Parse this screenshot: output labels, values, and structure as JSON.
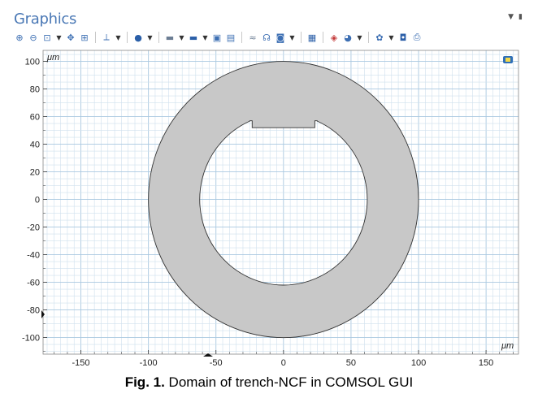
{
  "window": {
    "title": "Graphics"
  },
  "toolbar": {
    "icons": [
      "zoom-in-icon",
      "zoom-out-icon",
      "zoom-box-icon",
      "dropdown-arrow-icon",
      "move-icon",
      "zoom-extents-icon",
      "axis-orientation-icon",
      "dropdown-arrow-icon",
      "select-object-icon",
      "dropdown-arrow-icon",
      "scene-light-icon",
      "dropdown-arrow-icon",
      "camera-view-icon",
      "dropdown-arrow-icon",
      "select-box-icon",
      "deselect-box-icon",
      "hide-icon",
      "render-icon",
      "transparency-icon",
      "dropdown-arrow-icon",
      "grid-toggle-icon",
      "mesh-icon",
      "color-icon",
      "dropdown-arrow-icon",
      "settings-icon",
      "dropdown-arrow-icon",
      "snapshot-icon",
      "print-icon"
    ]
  },
  "axes": {
    "x_unit": "μm",
    "y_unit": "μm",
    "x_ticks": [
      "-150",
      "-100",
      "-50",
      "0",
      "50",
      "100",
      "150"
    ],
    "y_ticks": [
      "100",
      "80",
      "60",
      "40",
      "20",
      "0",
      "-20",
      "-40",
      "-60",
      "-80",
      "-100"
    ],
    "x_tick_values": [
      -150,
      -100,
      -50,
      0,
      50,
      100,
      150
    ],
    "y_tick_values": [
      100,
      80,
      60,
      40,
      20,
      0,
      -20,
      -40,
      -60,
      -80,
      -100
    ],
    "x_range": [
      -178,
      174
    ],
    "y_range": [
      -112,
      108
    ]
  },
  "geometry": {
    "outer_circle_radius": 100,
    "inner_circle_radius": 62,
    "trench_top_y": 57,
    "trench_bottom_y": 52,
    "trench_half_width": 25,
    "fill_color": "#c8c8c8",
    "stroke_color": "#333333",
    "grid_color": "#cfe0ee",
    "grid_major_color": "#a9c8e0"
  },
  "caption": {
    "label": "Fig. 1.",
    "text": " Domain of trench-NCF in COMSOL GUI"
  }
}
